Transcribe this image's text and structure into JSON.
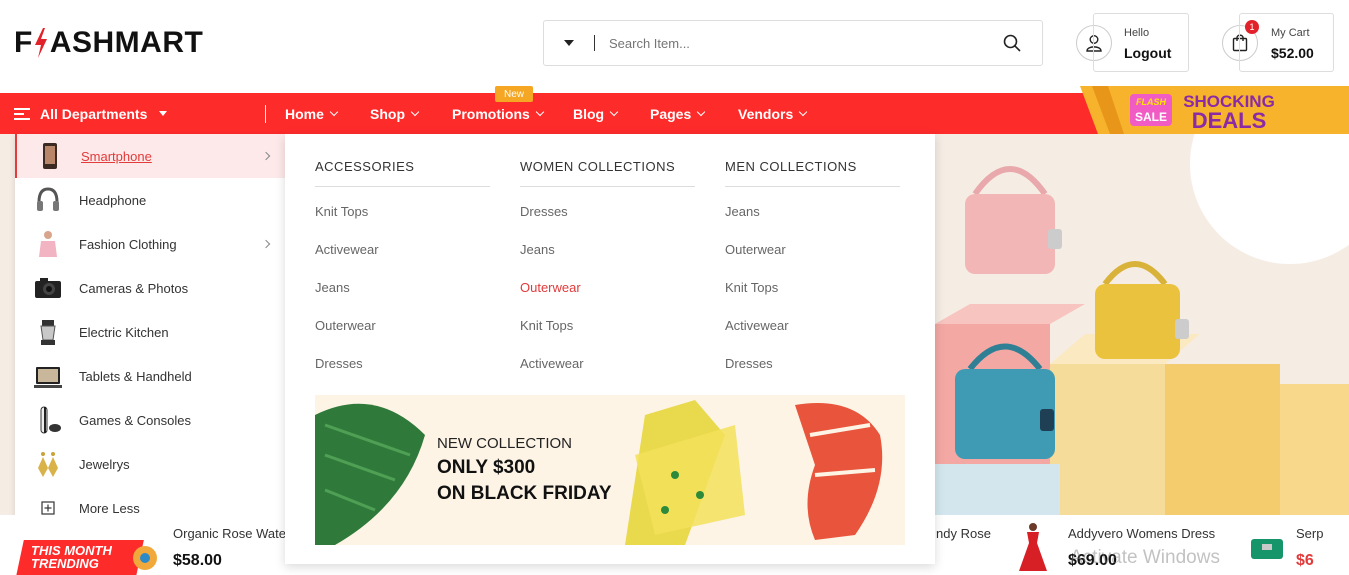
{
  "brand": {
    "logo_text_pre": "F",
    "logo_text_post": "ASHMART"
  },
  "search": {
    "placeholder": "Search Item..."
  },
  "account": {
    "greeting": "Hello",
    "action": "Logout"
  },
  "cart": {
    "label": "My Cart",
    "total": "$52.00",
    "count": "1"
  },
  "nav": {
    "all_departments": "All Departments",
    "items": [
      "Home",
      "Shop",
      "Promotions",
      "Blog",
      "Pages",
      "Vendors"
    ],
    "new_badge": "New",
    "deals_line1": "FLASH",
    "deals_line2": "SALE",
    "deals_line3": "SHOCKING",
    "deals_line4": "DEALS"
  },
  "sidebar": {
    "items": [
      {
        "label": "Smartphone",
        "icon": "smartphone-icon",
        "has_sub": true
      },
      {
        "label": "Headphone",
        "icon": "headphone-icon",
        "has_sub": false
      },
      {
        "label": "Fashion Clothing",
        "icon": "clothing-icon",
        "has_sub": true
      },
      {
        "label": "Cameras & Photos",
        "icon": "camera-icon",
        "has_sub": false
      },
      {
        "label": "Electric Kitchen",
        "icon": "kitchen-icon",
        "has_sub": false
      },
      {
        "label": "Tablets & Handheld",
        "icon": "tablet-icon",
        "has_sub": false
      },
      {
        "label": "Games & Consoles",
        "icon": "console-icon",
        "has_sub": false
      },
      {
        "label": "Jewelrys",
        "icon": "jewelry-icon",
        "has_sub": false
      },
      {
        "label": "More Less",
        "icon": "plus-box-icon",
        "has_sub": false
      }
    ]
  },
  "mega": {
    "columns": [
      {
        "title": "ACCESSORIES",
        "links": [
          "Knit Tops",
          "Activewear",
          "Jeans",
          "Outerwear",
          "Dresses"
        ]
      },
      {
        "title": "WOMEN COLLECTIONS",
        "links": [
          "Dresses",
          "Jeans",
          "Outerwear",
          "Knit Tops",
          "Activewear"
        ]
      },
      {
        "title": "MEN COLLECTIONS",
        "links": [
          "Jeans",
          "Outerwear",
          "Knit Tops",
          "Activewear",
          "Dresses"
        ]
      }
    ],
    "banner": {
      "line1": "NEW COLLECTION",
      "line2": "ONLY $300",
      "line3": "ON BLACK FRIDAY"
    }
  },
  "trending": {
    "tag_line1": "THIS MONTH",
    "tag_line2": "TRENDING",
    "products": [
      {
        "name": "Organic Rose Wate",
        "price": "$58.00"
      },
      {
        "name": "ndy Rose",
        "price": ""
      },
      {
        "name": "Addyvero Womens Dress",
        "price": "$69.00"
      },
      {
        "name": "Serp",
        "price": "$6"
      }
    ]
  },
  "watermark": "Activate Windows",
  "colors": {
    "primary": "#fe2b2b",
    "accent": "#e23b3b",
    "badge": "#f5a623"
  }
}
